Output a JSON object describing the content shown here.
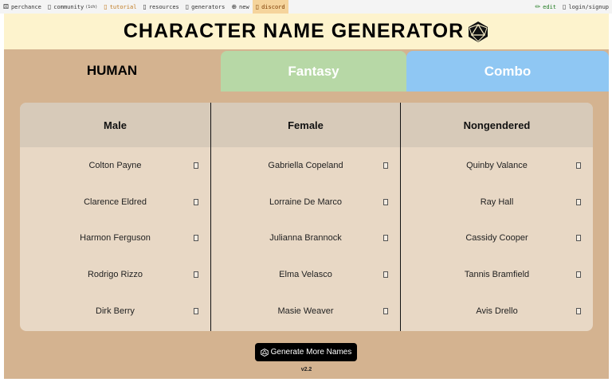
{
  "nav": {
    "items": [
      {
        "id": "perchance",
        "icon": "dice-icon",
        "glyph": "⚄",
        "label": "perchance"
      },
      {
        "id": "community",
        "icon": "people-icon",
        "glyph": "▯",
        "label": "community",
        "count": "(1ch)"
      },
      {
        "id": "tutorial",
        "icon": "book-icon",
        "glyph": "▯",
        "label": "tutorial"
      },
      {
        "id": "resources",
        "icon": "book-icon",
        "glyph": "▯",
        "label": "resources"
      },
      {
        "id": "generators",
        "icon": "list-icon",
        "glyph": "▯",
        "label": "generators"
      },
      {
        "id": "new",
        "icon": "plus-icon",
        "glyph": "⊕",
        "label": "new"
      },
      {
        "id": "discord",
        "icon": "chat-icon",
        "glyph": "▯",
        "label": "discord"
      }
    ],
    "right": [
      {
        "id": "edit",
        "icon": "pencil-icon",
        "glyph": "✏",
        "label": "edit"
      },
      {
        "id": "login",
        "icon": "user-icon",
        "glyph": "▯",
        "label": "login/signup"
      }
    ]
  },
  "app": {
    "title": "CHARACTER NAME GENERATOR",
    "tabs": [
      {
        "label": "HUMAN",
        "active": true
      },
      {
        "label": "Fantasy",
        "active": false
      },
      {
        "label": "Combo",
        "active": false
      }
    ],
    "columns": [
      {
        "header": "Male",
        "names": [
          "Colton Payne",
          "Clarence Eldred",
          "Harmon Ferguson",
          "Rodrigo Rizzo",
          "Dirk Berry"
        ]
      },
      {
        "header": "Female",
        "names": [
          "Gabriella Copeland",
          "Lorraine De Marco",
          "Julianna Brannock",
          "Elma Velasco",
          "Masie Weaver"
        ]
      },
      {
        "header": "Nongendered",
        "names": [
          "Quinby Valance",
          "Ray Hall",
          "Cassidy Cooper",
          "Tannis Bramfield",
          "Avis Drello"
        ]
      }
    ],
    "generate_button": "Generate More Names",
    "version": "v2.2"
  },
  "colors": {
    "human_tab": "#d4b390",
    "fantasy_tab": "#b7d8a6",
    "combo_tab": "#8fc7f3",
    "title_bg": "#fdf3cd",
    "panel_bg": "#e8d8c5",
    "header_bg": "#d7cab9"
  }
}
